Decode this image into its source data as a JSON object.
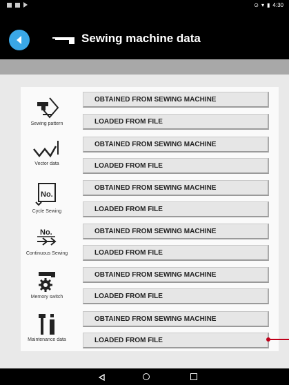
{
  "status": {
    "time": "4:30"
  },
  "header": {
    "title": "Sewing machine data"
  },
  "buttons": {
    "obtained": "OBTAINED FROM SEWING MACHINE",
    "loaded": "LOADED FROM FILE"
  },
  "rows": [
    {
      "label": "Sewing pattern",
      "icon": "sewing-pattern-icon"
    },
    {
      "label": "Vector data",
      "icon": "vector-data-icon"
    },
    {
      "label": "Cycle Sewing",
      "icon": "cycle-sewing-icon"
    },
    {
      "label": "Continuous Sewing",
      "icon": "continuous-sewing-icon"
    },
    {
      "label": "Memory switch",
      "icon": "memory-switch-icon"
    },
    {
      "label": "Maintenance data",
      "icon": "maintenance-data-icon"
    }
  ],
  "colors": {
    "accent": "#3aa7e6",
    "marker": "#c0001a"
  }
}
